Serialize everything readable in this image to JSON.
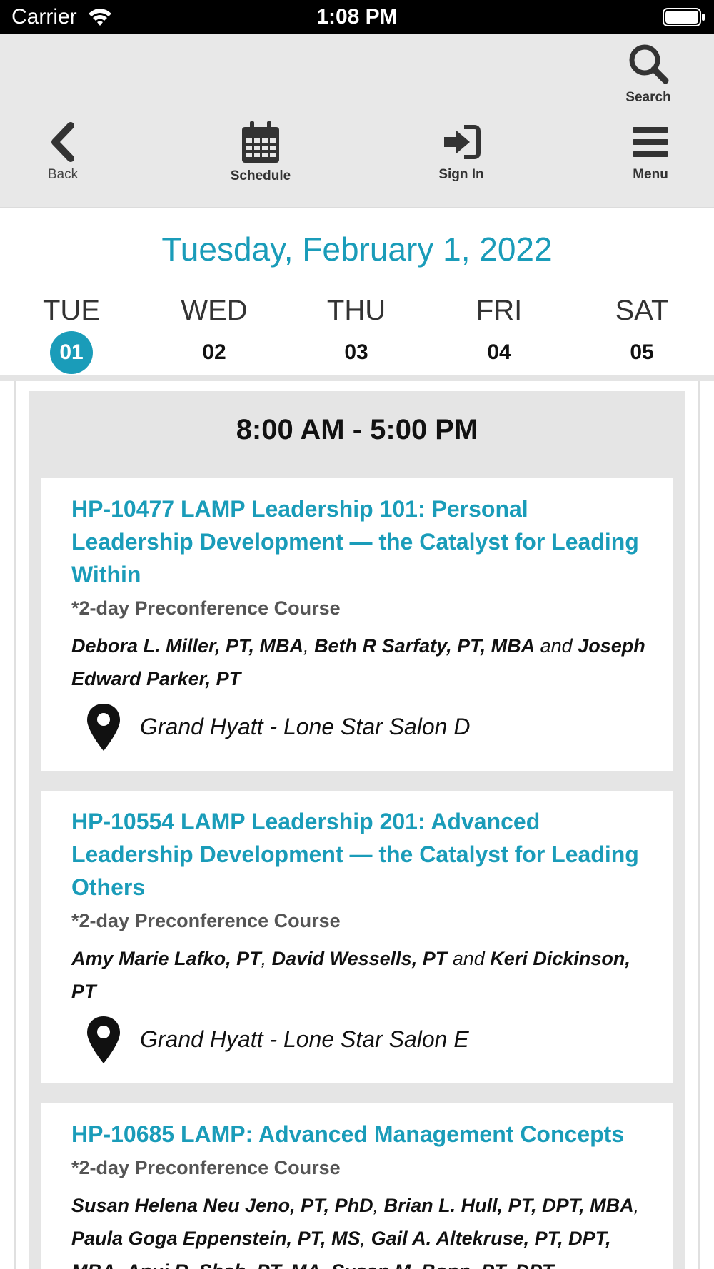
{
  "status_bar": {
    "carrier": "Carrier",
    "time": "1:08 PM"
  },
  "toolbar": {
    "search": {
      "label": "Search",
      "icon": "search-icon"
    },
    "back": {
      "label": "Back",
      "icon": "chevron-left-icon"
    },
    "schedule": {
      "label": "Schedule",
      "icon": "calendar-icon"
    },
    "signin": {
      "label": "Sign In",
      "icon": "sign-in-icon"
    },
    "menu": {
      "label": "Menu",
      "icon": "hamburger-icon"
    }
  },
  "date_header": {
    "title": "Tuesday, February 1, 2022"
  },
  "days": [
    {
      "name": "TUE",
      "num": "01",
      "active": true
    },
    {
      "name": "WED",
      "num": "02"
    },
    {
      "name": "THU",
      "num": "03"
    },
    {
      "name": "FRI",
      "num": "04"
    },
    {
      "name": "SAT",
      "num": "05"
    }
  ],
  "time_block": {
    "label": "8:00 AM - 5:00 PM"
  },
  "sessions": [
    {
      "title": "HP-10477 LAMP Leadership 101: Personal Leadership Development — the Catalyst for Leading Within",
      "subtitle": "*2-day Preconference Course",
      "speakers": [
        "Debora L. Miller, PT, MBA",
        "Beth R Sarfaty, PT, MBA",
        "Joseph Edward Parker, PT"
      ],
      "location": "Grand Hyatt - Lone Star Salon D"
    },
    {
      "title": "HP-10554 LAMP Leadership 201: Advanced Leadership Development — the Catalyst for Leading Others",
      "subtitle": "*2-day Preconference Course",
      "speakers": [
        "Amy Marie Lafko, PT",
        "David Wessells, PT",
        "Keri Dickinson, PT"
      ],
      "location": "Grand Hyatt - Lone Star Salon E"
    },
    {
      "title": "HP-10685 LAMP: Advanced Management Concepts",
      "subtitle": "*2-day Preconference Course",
      "speakers": [
        "Susan Helena Neu Jeno, PT, PhD",
        "Brian L. Hull, PT, DPT, MBA",
        "Paula Goga Eppenstein, PT, MS",
        "Gail A. Altekruse, PT, DPT, MBA",
        "Anuj R. Shah, PT, MA",
        "Susan M. Bopp, PT, DPT"
      ]
    }
  ],
  "colors": {
    "accent": "#1a9cb9",
    "toolbar_bg": "#e8e8e8",
    "block_bg": "#e5e5e5"
  }
}
